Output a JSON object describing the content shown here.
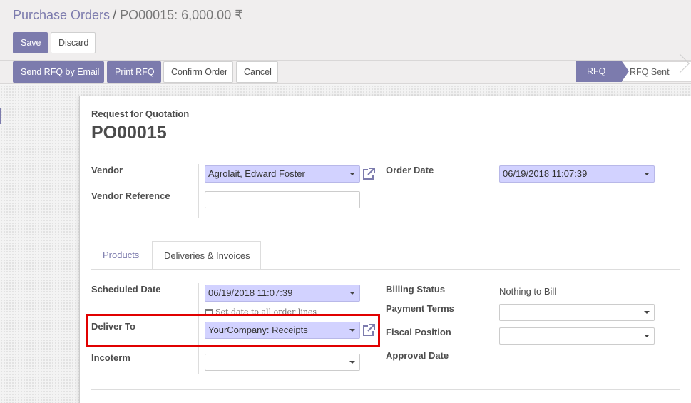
{
  "breadcrumb": {
    "parent": "Purchase Orders",
    "separator": "/",
    "current": "PO00015: 6,000.00 ₹"
  },
  "actions": {
    "save": "Save",
    "discard": "Discard"
  },
  "header_buttons": {
    "send_rfq": "Send RFQ by Email",
    "print_rfq": "Print RFQ",
    "confirm": "Confirm Order",
    "cancel": "Cancel"
  },
  "status": {
    "active": "RFQ",
    "next": "RFQ Sent"
  },
  "form": {
    "subtitle": "Request for Quotation",
    "title": "PO00015",
    "vendor_label": "Vendor",
    "vendor_value": "Agrolait, Edward Foster",
    "vendor_ref_label": "Vendor Reference",
    "vendor_ref_value": "",
    "order_date_label": "Order Date",
    "order_date_value": "06/19/2018 11:07:39"
  },
  "tabs": {
    "products": "Products",
    "deliveries": "Deliveries & Invoices"
  },
  "deliveries": {
    "scheduled_date_label": "Scheduled Date",
    "scheduled_date_value": "06/19/2018 11:07:39",
    "set_date_hint": "Set date to all order lines",
    "deliver_to_label": "Deliver To",
    "deliver_to_value": "YourCompany: Receipts",
    "incoterm_label": "Incoterm",
    "incoterm_value": "",
    "billing_status_label": "Billing Status",
    "billing_status_value": "Nothing to Bill",
    "payment_terms_label": "Payment Terms",
    "payment_terms_value": "",
    "fiscal_position_label": "Fiscal Position",
    "fiscal_position_value": "",
    "approval_date_label": "Approval Date"
  },
  "colors": {
    "accent": "#7c7bad",
    "required_field": "#d2d2ff",
    "highlight": "#e10000"
  },
  "icons": {
    "external_link": "external-link-icon",
    "dropdown": "caret-down-icon",
    "calendar": "calendar-icon"
  }
}
